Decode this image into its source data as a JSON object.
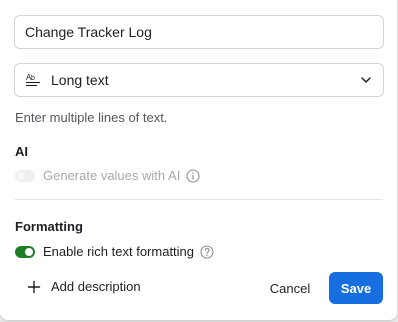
{
  "field": {
    "name_value": "Change Tracker Log",
    "type_icon": "long-text-icon",
    "type_label": "Long text",
    "type_hint": "Enter multiple lines of text."
  },
  "ai": {
    "title": "AI",
    "toggle_label": "Generate values with AI",
    "enabled": false
  },
  "formatting": {
    "title": "Formatting",
    "toggle_label": "Enable rich text formatting",
    "enabled": true
  },
  "footer": {
    "add_description_label": "Add description",
    "cancel_label": "Cancel",
    "save_label": "Save"
  },
  "colors": {
    "accent": "#166ee1",
    "toggle_on": "#1e7e25",
    "border": "#d3d5d8"
  }
}
